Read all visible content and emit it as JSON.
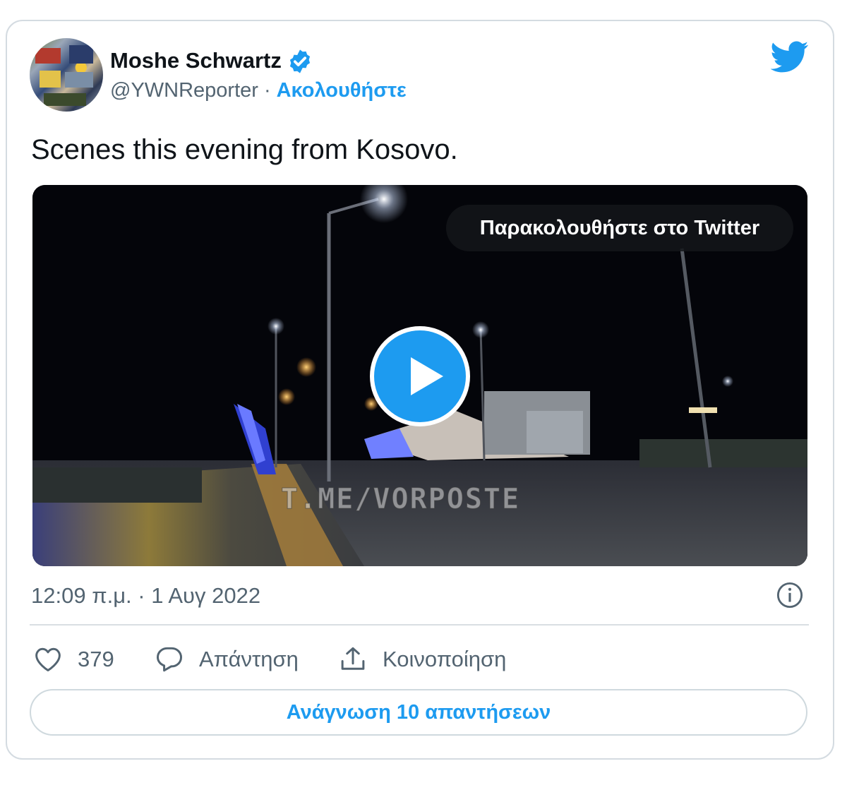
{
  "author": {
    "name": "Moshe Schwartz",
    "handle": "@YWNReporter",
    "separator": "·",
    "follow_label": "Ακολουθήστε",
    "verified": true
  },
  "tweet": {
    "text": "Scenes this evening from Kosovo."
  },
  "media": {
    "watch_label": "Παρακολουθήστε στο Twitter",
    "watermark": "T.ME/VORPOSTE"
  },
  "meta": {
    "timestamp": "12:09 π.μ. · 1 Αυγ 2022"
  },
  "actions": {
    "likes_count": "379",
    "reply_label": "Απάντηση",
    "share_label": "Κοινοποίηση"
  },
  "read_replies_label": "Ανάγνωση 10 απαντήσεων",
  "colors": {
    "accent": "#1d9bf0",
    "text": "#0f1419",
    "secondary": "#536471",
    "border": "#cfd9de"
  },
  "icons": [
    "verified-badge-icon",
    "twitter-bird-icon",
    "play-icon",
    "info-icon",
    "heart-icon",
    "reply-icon",
    "share-icon"
  ]
}
